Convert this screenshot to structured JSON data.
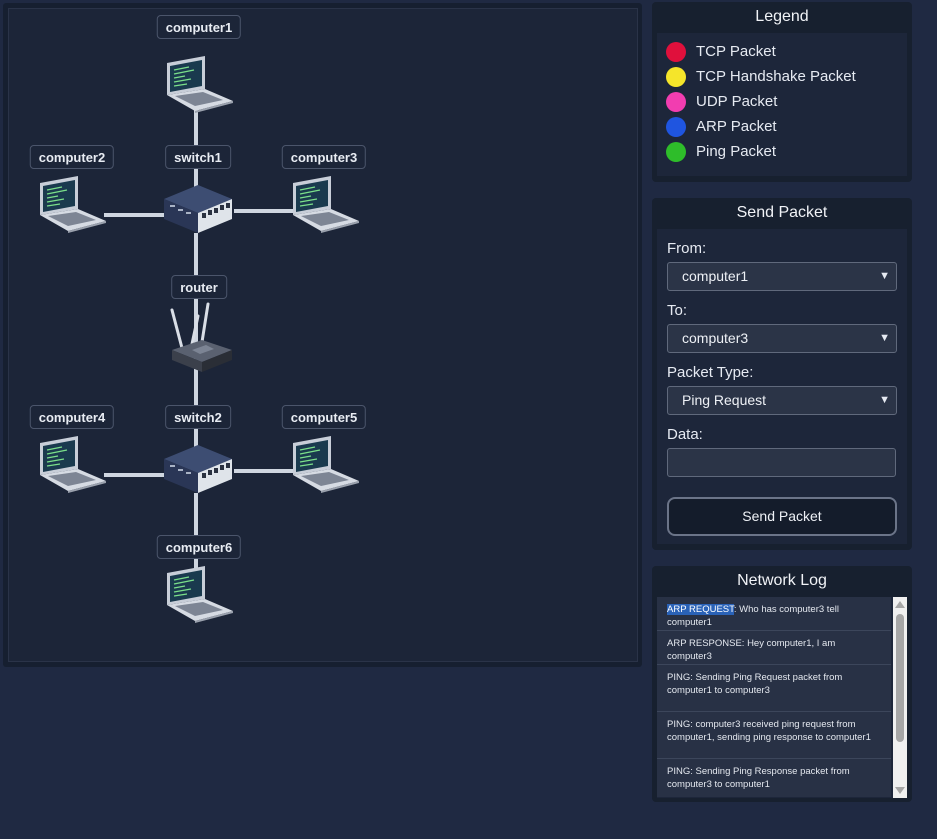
{
  "topology": {
    "nodes": {
      "computer1": "computer1",
      "computer2": "computer2",
      "computer3": "computer3",
      "computer4": "computer4",
      "computer5": "computer5",
      "computer6": "computer6",
      "switch1": "switch1",
      "switch2": "switch2",
      "router": "router"
    }
  },
  "legend": {
    "title": "Legend",
    "items": [
      {
        "label": "TCP Packet",
        "color": "#e0103c"
      },
      {
        "label": "TCP Handshake Packet",
        "color": "#f5e52a"
      },
      {
        "label": "UDP Packet",
        "color": "#f23db0"
      },
      {
        "label": "ARP Packet",
        "color": "#1f55e0"
      },
      {
        "label": "Ping Packet",
        "color": "#2ebd2a"
      }
    ]
  },
  "send_packet": {
    "title": "Send Packet",
    "from_label": "From:",
    "from_value": "computer1",
    "to_label": "To:",
    "to_value": "computer3",
    "type_label": "Packet Type:",
    "type_value": "Ping Request",
    "data_label": "Data:",
    "data_value": "",
    "button_label": "Send Packet"
  },
  "network_log": {
    "title": "Network Log",
    "entries": [
      {
        "prefix": "ARP REQUEST",
        "text": ": Who has computer3 tell computer1"
      },
      {
        "prefix": "",
        "text": "ARP RESPONSE: Hey computer1, I am computer3"
      },
      {
        "prefix": "",
        "text": "PING: Sending Ping Request packet from computer1 to computer3"
      },
      {
        "prefix": "",
        "text": "PING: computer3 received ping request from computer1, sending ping response to computer1"
      },
      {
        "prefix": "",
        "text": "PING: Sending Ping Response packet from computer3 to computer1"
      }
    ]
  }
}
